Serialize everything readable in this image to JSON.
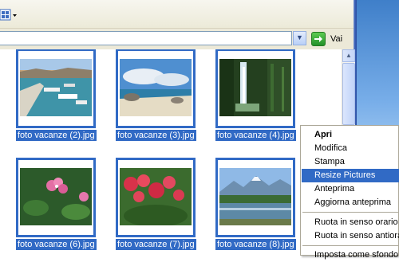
{
  "toolbar": {
    "views_icon": "thumbnail-views-icon"
  },
  "address_bar": {
    "value": "",
    "go_label": "Vai"
  },
  "files": [
    {
      "name": "foto vacanze (2).jpg",
      "image": "harbor-boats"
    },
    {
      "name": "foto vacanze (3).jpg",
      "image": "beach-rocks"
    },
    {
      "name": "foto vacanze (4).jpg",
      "image": "waterfall"
    },
    {
      "name": "foto vacanze (6).jpg",
      "image": "pink-flowers"
    },
    {
      "name": "foto vacanze (7).jpg",
      "image": "red-flowers"
    },
    {
      "name": "foto vacanze (8).jpg",
      "image": "mountain-river"
    }
  ],
  "context_menu": {
    "items": [
      {
        "label": "Apri",
        "bold": true
      },
      {
        "label": "Modifica"
      },
      {
        "label": "Stampa"
      },
      {
        "label": "Resize Pictures",
        "highlighted": true
      },
      {
        "label": "Anteprima"
      },
      {
        "label": "Aggiorna anteprima"
      },
      {
        "label": "Ruota in senso orario"
      },
      {
        "label": "Ruota in senso antiorario"
      },
      {
        "label": "Imposta come sfondo"
      }
    ]
  },
  "colors": {
    "selection": "#316ac5",
    "toolbar": "#ece9d8"
  }
}
